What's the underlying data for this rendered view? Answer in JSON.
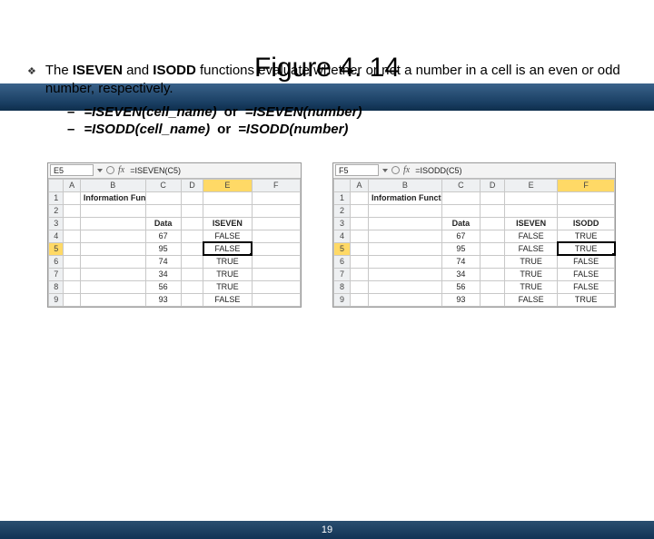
{
  "title": "Figure 4. 14",
  "bullet": {
    "pre": "The ",
    "b1": "ISEVEN",
    "mid1": " and ",
    "b2": "ISODD",
    "post": " functions evaluate whether or not a number in a cell is an even or odd number, respectively."
  },
  "syntax": [
    {
      "a": "=ISEVEN(cell_name)",
      "or": "or",
      "b": "=ISEVEN(number)"
    },
    {
      "a": "=ISODD(cell_name)",
      "or": "or",
      "b": "=ISODD(number)"
    }
  ],
  "left": {
    "name": "E5",
    "formula": "=ISEVEN(C5)",
    "cols": [
      "A",
      "B",
      "C",
      "D",
      "E",
      "F"
    ],
    "rows": [
      {
        "n": "1",
        "B": "Information Functions"
      },
      {
        "n": "2"
      },
      {
        "n": "3",
        "C": "Data",
        "E": "ISEVEN"
      },
      {
        "n": "4",
        "C": "67",
        "E": "FALSE"
      },
      {
        "n": "5",
        "C": "95",
        "E": "FALSE",
        "selE": true
      },
      {
        "n": "6",
        "C": "74",
        "E": "TRUE"
      },
      {
        "n": "7",
        "C": "34",
        "E": "TRUE"
      },
      {
        "n": "8",
        "C": "56",
        "E": "TRUE"
      },
      {
        "n": "9",
        "C": "93",
        "E": "FALSE"
      }
    ]
  },
  "right": {
    "name": "F5",
    "formula": "=ISODD(C5)",
    "cols": [
      "A",
      "B",
      "C",
      "D",
      "E",
      "F"
    ],
    "rows": [
      {
        "n": "1",
        "B": "Information Functions"
      },
      {
        "n": "2"
      },
      {
        "n": "3",
        "C": "Data",
        "E": "ISEVEN",
        "F": "ISODD"
      },
      {
        "n": "4",
        "C": "67",
        "E": "FALSE",
        "F": "TRUE"
      },
      {
        "n": "5",
        "C": "95",
        "E": "FALSE",
        "F": "TRUE",
        "selF": true
      },
      {
        "n": "6",
        "C": "74",
        "E": "TRUE",
        "F": "FALSE"
      },
      {
        "n": "7",
        "C": "34",
        "E": "TRUE",
        "F": "FALSE"
      },
      {
        "n": "8",
        "C": "56",
        "E": "TRUE",
        "F": "FALSE"
      },
      {
        "n": "9",
        "C": "93",
        "E": "FALSE",
        "F": "TRUE"
      }
    ]
  },
  "page": "19"
}
